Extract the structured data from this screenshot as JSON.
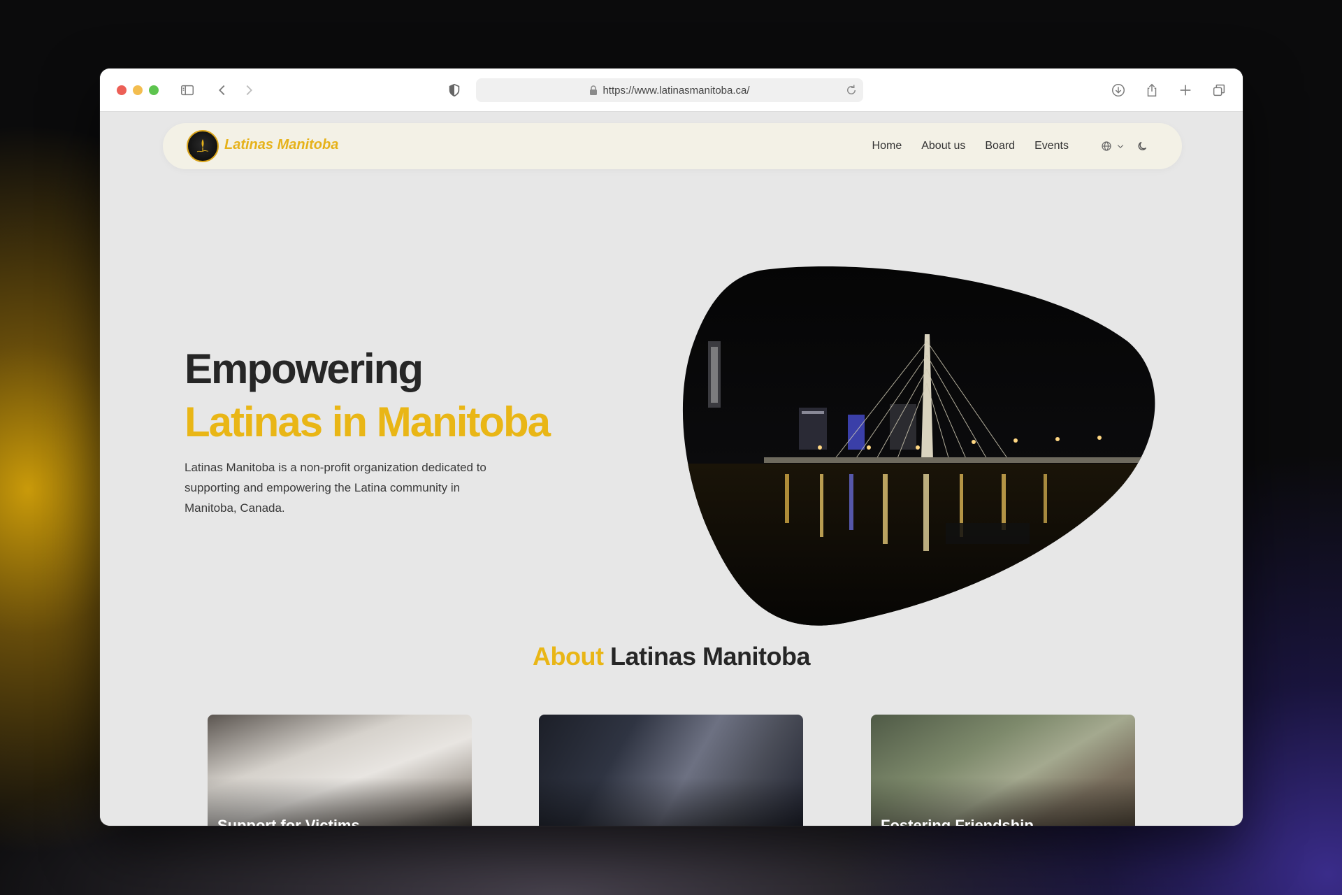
{
  "browser": {
    "url": "https://www.latinasmanitoba.ca/",
    "icons": [
      "sidebar-icon",
      "back-icon",
      "forward-icon",
      "shield-icon",
      "lock-icon",
      "reload-icon",
      "download-icon",
      "share-icon",
      "new-tab-icon",
      "tabs-icon"
    ]
  },
  "nav": {
    "brand": "Latinas Manitoba",
    "links": [
      "Home",
      "About us",
      "Board",
      "Events"
    ]
  },
  "hero": {
    "heading_line1": "Empowering",
    "heading_line2": "Latinas in Manitoba",
    "description": "Latinas Manitoba is a non-profit organization dedicated to supporting and empowering the Latina community in Manitoba, Canada."
  },
  "about": {
    "title_accent": "About",
    "title_rest": "Latinas Manitoba"
  },
  "cards": [
    {
      "title": "Support for Victims"
    },
    {
      "title": ""
    },
    {
      "title": "Fostering Friendship"
    }
  ],
  "colors": {
    "accent": "#e9b616",
    "text": "#262626",
    "nav_bg": "#f3f1e6",
    "page_bg": "#e7e7e7"
  }
}
